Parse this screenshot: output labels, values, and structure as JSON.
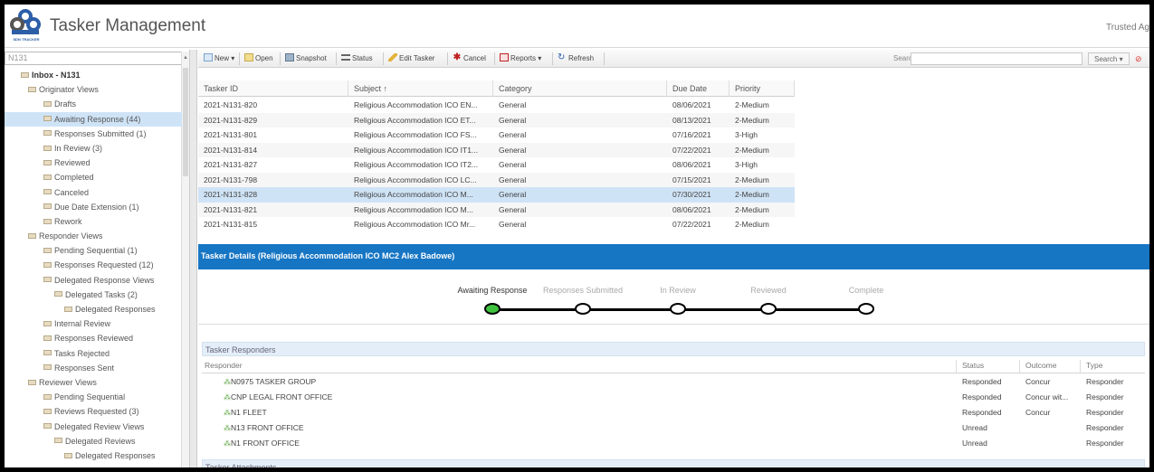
{
  "app": {
    "title": "Tasker Management",
    "logo_caption": "SDN TRACKER",
    "trusted_text": "Trusted Ag"
  },
  "sidebar": {
    "search_value": "N131",
    "items": [
      {
        "label": "Inbox - N131",
        "level": 0,
        "bold": true,
        "selected": false
      },
      {
        "label": "Originator Views",
        "level": 1,
        "bold": false,
        "selected": false
      },
      {
        "label": "Drafts",
        "level": 2,
        "bold": false,
        "selected": false
      },
      {
        "label": "Awaiting Response (44)",
        "level": 2,
        "bold": false,
        "selected": true
      },
      {
        "label": "Responses Submitted (1)",
        "level": 2,
        "bold": false,
        "selected": false
      },
      {
        "label": "In Review (3)",
        "level": 2,
        "bold": false,
        "selected": false
      },
      {
        "label": "Reviewed",
        "level": 2,
        "bold": false,
        "selected": false
      },
      {
        "label": "Completed",
        "level": 2,
        "bold": false,
        "selected": false
      },
      {
        "label": "Canceled",
        "level": 2,
        "bold": false,
        "selected": false
      },
      {
        "label": "Due Date Extension (1)",
        "level": 2,
        "bold": false,
        "selected": false
      },
      {
        "label": "Rework",
        "level": 2,
        "bold": false,
        "selected": false
      },
      {
        "label": "Responder Views",
        "level": 1,
        "bold": false,
        "selected": false
      },
      {
        "label": "Pending Sequential (1)",
        "level": 2,
        "bold": false,
        "selected": false
      },
      {
        "label": "Responses Requested (12)",
        "level": 2,
        "bold": false,
        "selected": false
      },
      {
        "label": "Delegated Response Views",
        "level": 2,
        "bold": false,
        "selected": false
      },
      {
        "label": "Delegated Tasks (2)",
        "level": 3,
        "bold": false,
        "selected": false
      },
      {
        "label": "Delegated Responses",
        "level": 4,
        "bold": false,
        "selected": false
      },
      {
        "label": "Internal Review",
        "level": 2,
        "bold": false,
        "selected": false
      },
      {
        "label": "Responses Reviewed",
        "level": 2,
        "bold": false,
        "selected": false
      },
      {
        "label": "Tasks Rejected",
        "level": 2,
        "bold": false,
        "selected": false
      },
      {
        "label": "Responses Sent",
        "level": 2,
        "bold": false,
        "selected": false
      },
      {
        "label": "Reviewer Views",
        "level": 1,
        "bold": false,
        "selected": false
      },
      {
        "label": "Pending Sequential",
        "level": 2,
        "bold": false,
        "selected": false
      },
      {
        "label": "Reviews Requested (3)",
        "level": 2,
        "bold": false,
        "selected": false
      },
      {
        "label": "Delegated Review Views",
        "level": 2,
        "bold": false,
        "selected": false
      },
      {
        "label": "Delegated Reviews",
        "level": 3,
        "bold": false,
        "selected": false
      },
      {
        "label": "Delegated Responses",
        "level": 4,
        "bold": false,
        "selected": false
      }
    ]
  },
  "toolbar": {
    "new_label": "New",
    "open_label": "Open",
    "snapshot_label": "Snapshot",
    "status_label": "Status",
    "edit_label": "Edit Tasker",
    "cancel_label": "Cancel",
    "reports_label": "Reports",
    "refresh_label": "Refresh",
    "search_label": "Search:",
    "search_button_label": "Search",
    "search_value": ""
  },
  "grid": {
    "headers": [
      "Tasker ID",
      "Subject ↑",
      "Category",
      "Due Date",
      "Priority"
    ],
    "rows": [
      [
        "2021-N131-820",
        "Religious Accommodation ICO EN...",
        "General",
        "08/06/2021",
        "2-Medium"
      ],
      [
        "2021-N131-829",
        "Religious Accommodation ICO ET...",
        "General",
        "08/13/2021",
        "2-Medium"
      ],
      [
        "2021-N131-801",
        "Religious Accommodation ICO FS...",
        "General",
        "07/16/2021",
        "3-High"
      ],
      [
        "2021-N131-814",
        "Religious Accommodation ICO IT1...",
        "General",
        "07/22/2021",
        "2-Medium"
      ],
      [
        "2021-N131-827",
        "Religious Accommodation ICO IT2...",
        "General",
        "08/06/2021",
        "3-High"
      ],
      [
        "2021-N131-798",
        "Religious Accommodation ICO LC...",
        "General",
        "07/15/2021",
        "2-Medium"
      ],
      [
        "2021-N131-828",
        "Religious Accommodation ICO M...",
        "General",
        "07/30/2021",
        "2-Medium"
      ],
      [
        "2021-N131-821",
        "Religious Accommodation ICO M...",
        "General",
        "08/06/2021",
        "2-Medium"
      ],
      [
        "2021-N131-815",
        "Religious Accommodation ICO Mr...",
        "General",
        "07/22/2021",
        "2-Medium"
      ]
    ],
    "selected_row": 6
  },
  "details": {
    "title": "Tasker Details (Religious Accommodation ICO MC2 Alex Badowe)",
    "stages": [
      {
        "label": "Awaiting Response",
        "active": true
      },
      {
        "label": "Responses Submitted",
        "active": false
      },
      {
        "label": "In Review",
        "active": false
      },
      {
        "label": "Reviewed",
        "active": false
      },
      {
        "label": "Complete",
        "active": false
      }
    ],
    "accent_green": "#3fc33f",
    "banner_color": "#1776c4"
  },
  "responders": {
    "section_title": "Tasker Responders",
    "headers": {
      "responder": "Responder",
      "status": "Status",
      "outcome": "Outcome",
      "type": "Type"
    },
    "rows": [
      {
        "name": "N0975 TASKER GROUP",
        "status": "Responded",
        "outcome": "Concur",
        "type": "Responder"
      },
      {
        "name": "CNP LEGAL FRONT OFFICE",
        "status": "Responded",
        "outcome": "Concur wit...",
        "type": "Responder"
      },
      {
        "name": "N1 FLEET",
        "status": "Responded",
        "outcome": "Concur",
        "type": "Responder"
      },
      {
        "name": "N13 FRONT OFFICE",
        "status": "Unread",
        "outcome": "",
        "type": "Responder"
      },
      {
        "name": "N1 FRONT OFFICE",
        "status": "Unread",
        "outcome": "",
        "type": "Responder"
      }
    ]
  },
  "attachments": {
    "section_title": "Tasker Attachments"
  }
}
